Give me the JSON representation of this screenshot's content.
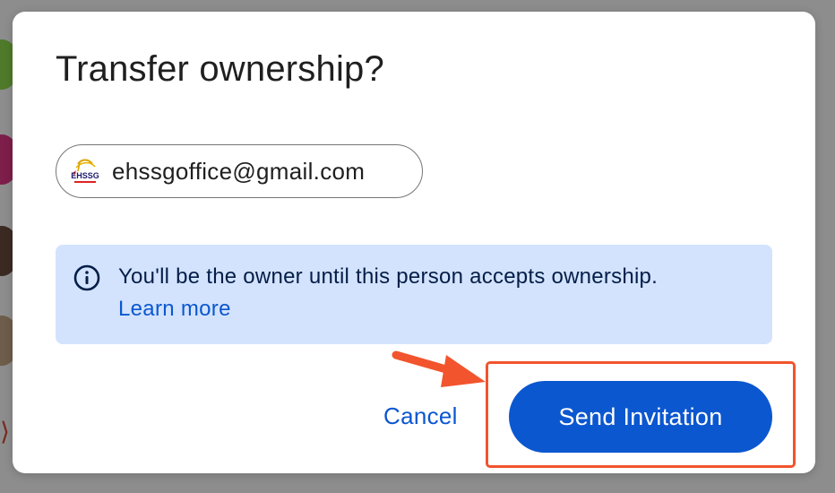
{
  "dialog": {
    "title": "Transfer ownership?",
    "recipient": {
      "email": "ehssgoffice@gmail.com",
      "avatar_label": "EHSSG"
    },
    "info": {
      "icon": "info-icon",
      "message": "You'll be the owner until this person accepts ownership.",
      "link_label": "Learn more"
    },
    "actions": {
      "cancel_label": "Cancel",
      "send_label": "Send Invitation"
    }
  },
  "colors": {
    "primary": "#0b57d0",
    "info_background": "#d3e3fd",
    "info_text": "#041e49",
    "annotation": "#f2542d",
    "scrim": "#8d8d8d"
  }
}
